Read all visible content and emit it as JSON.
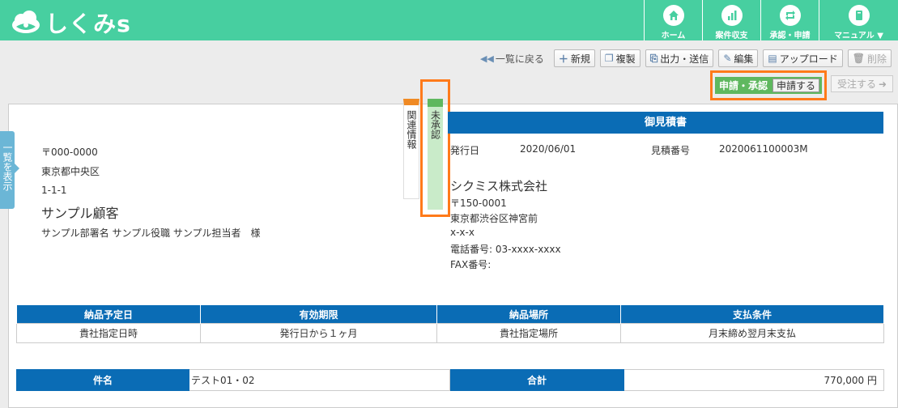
{
  "header": {
    "logo_text": "しくみs",
    "nav": [
      {
        "label": "ホーム",
        "icon": "home-icon"
      },
      {
        "label": "案件収支",
        "icon": "bar-chart-icon"
      },
      {
        "label": "承認・申請",
        "icon": "repeat-icon"
      },
      {
        "label": "マニュアル ▼",
        "icon": "book-icon"
      }
    ]
  },
  "toolbar": {
    "back": "一覧に戻る",
    "new": "新規",
    "copy": "複製",
    "output": "出力・送信",
    "edit": "編集",
    "upload": "アップロード",
    "delete": "削除",
    "approval_label": "申請・承認",
    "apply": "申請する",
    "accept_order": "受注する"
  },
  "side_tab": "一覧を表示",
  "related_tab": "関連情報",
  "status_tab": "未承認",
  "customer": {
    "postal": "〒000-0000",
    "city": "東京都中央区",
    "street": "1-1-1",
    "name": "サンプル顧客",
    "contact": "サンプル部署名 サンプル役職 サンプル担当者　様"
  },
  "document": {
    "title": "御見積書",
    "issue_date_label": "発行日",
    "issue_date": "2020/06/01",
    "number_label": "見積番号",
    "number": "2020061100003M"
  },
  "company": {
    "name": "シクミス株式会社",
    "postal": "〒150-0001",
    "address": "東京都渋谷区神宮前",
    "street": "x-x-x",
    "phone": "電話番号:  03-xxxx-xxxx",
    "fax": "FAX番号:"
  },
  "terms": {
    "headers": [
      "納品予定日",
      "有効期限",
      "納品場所",
      "支払条件"
    ],
    "values": [
      "貴社指定日時",
      "発行日から１ヶ月",
      "貴社指定場所",
      "月末締め翌月末支払"
    ]
  },
  "summary": {
    "subject_label": "件名",
    "subject": "テスト01・02",
    "total_label": "合計",
    "total": "770,000 円"
  },
  "colors": {
    "header": "#47cfa0",
    "title_bar": "#0a6cb5",
    "approval": "#5fb85f",
    "highlight": "#ff7a1a",
    "related": "#f08a24"
  }
}
